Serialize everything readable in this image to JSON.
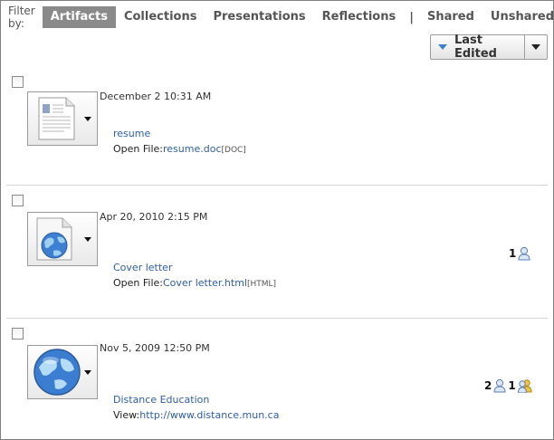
{
  "filter": {
    "label": "Filter by:",
    "items": [
      "Artifacts",
      "Collections",
      "Presentations",
      "Reflections"
    ],
    "separator": "|",
    "share_items": [
      "Shared",
      "Unshared"
    ],
    "active": "Artifacts"
  },
  "sort": {
    "label": "Last Edited"
  },
  "items": [
    {
      "date": "December 2 10:31 AM",
      "title": "resume",
      "link_prefix": "Open File:",
      "link_text": "resume.doc",
      "file_type": "[DOC]",
      "icon": "document-icon"
    },
    {
      "date": "Apr 20, 2010 2:15 PM",
      "title": "Cover letter",
      "link_prefix": "Open File:",
      "link_text": "Cover letter.html",
      "file_type": "[HTML]",
      "icon": "web-page-icon",
      "share_count_user": "1"
    },
    {
      "date": "Nov 5, 2009 12:50 PM",
      "title": "Distance Education",
      "link_prefix": "View:",
      "link_text": "http://www.distance.mun.ca",
      "icon": "globe-icon",
      "share_count_user": "2",
      "share_count_group": "1"
    }
  ],
  "colors": {
    "link": "#2e5ea8",
    "active_filter_bg": "#8a8a8a",
    "sort_arrow": "#3f7ec8"
  }
}
